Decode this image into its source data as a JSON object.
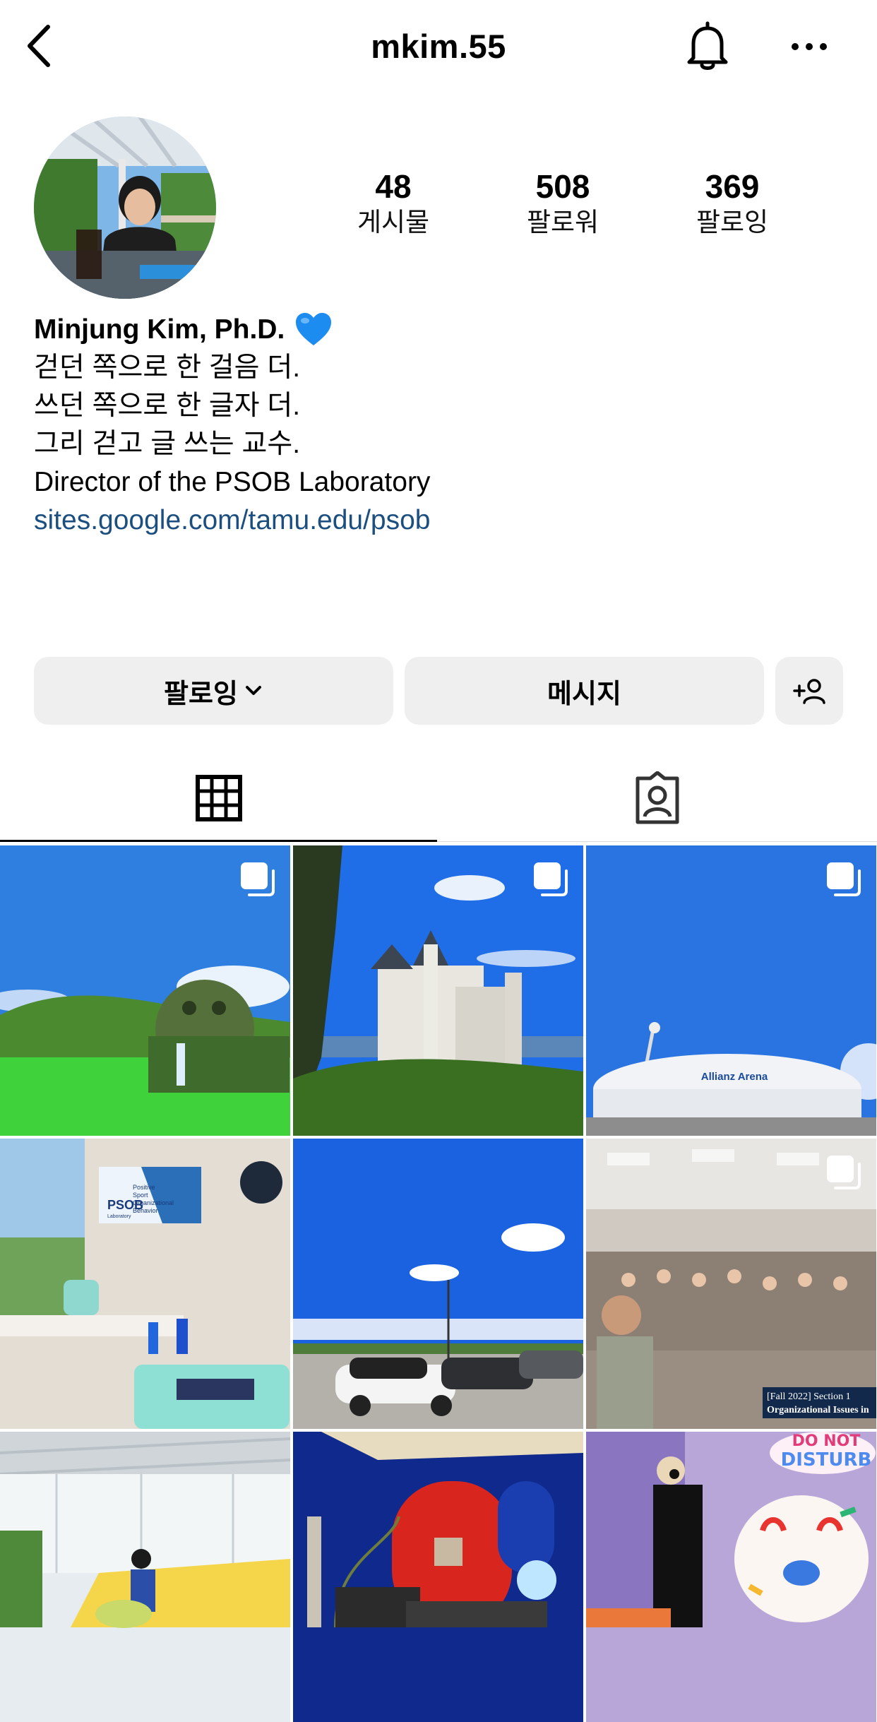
{
  "header": {
    "username": "mkim.55",
    "back_icon": "chevron-left-icon",
    "bell_icon": "bell-icon",
    "more_icon": "more-horizontal-icon"
  },
  "stats": [
    {
      "value": "48",
      "label": "게시물"
    },
    {
      "value": "508",
      "label": "팔로워"
    },
    {
      "value": "369",
      "label": "팔로잉"
    }
  ],
  "bio": {
    "name": "Minjung Kim, Ph.D.",
    "emoji": "blue-heart-icon",
    "lines": [
      "걷던 쪽으로 한 걸음 더.",
      "쓰던 쪽으로 한 글자 더.",
      "그리 걷고 글 쓰는 교수.",
      "Director of the PSOB Laboratory"
    ],
    "link": "sites.google.com/tamu.edu/psob"
  },
  "buttons": {
    "following": "팔로잉",
    "message": "메시지"
  },
  "tabs": [
    "grid-icon",
    "tagged-user-icon"
  ],
  "posts": [
    {
      "id": "post-crystal-worlds-giant",
      "multi": true
    },
    {
      "id": "post-neuschwanstein-castle",
      "multi": true
    },
    {
      "id": "post-allianz-arena",
      "multi": true,
      "label": "Allianz Arena"
    },
    {
      "id": "post-psob-lab-office",
      "multi": false,
      "label": "PSOB",
      "banner_lines": [
        "Positive",
        "Sport",
        "Organizational",
        "Behavior"
      ],
      "sub": "Laboratory"
    },
    {
      "id": "post-parking-lot-sky",
      "multi": false
    },
    {
      "id": "post-classroom",
      "multi": true,
      "caption_lines": [
        "[Fall 2022] Section 1",
        "Organizational Issues in"
      ]
    },
    {
      "id": "post-gym-hallway",
      "multi": false
    },
    {
      "id": "post-restaurant-interior",
      "multi": false
    },
    {
      "id": "post-do-not-disturb",
      "multi": false,
      "label_lines": [
        "DO NOT",
        "DISTURB"
      ]
    }
  ],
  "colors": {
    "link": "#1c4f7f",
    "button_bg": "#efefef",
    "divider": "#dbdbdb",
    "heart": "#1d8cf0"
  }
}
